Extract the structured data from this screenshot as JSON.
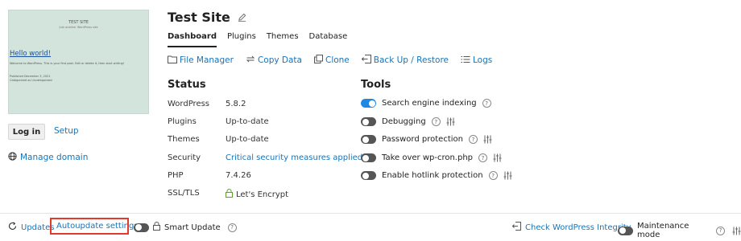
{
  "preview": {
    "site_title": "TEST SITE",
    "site_tagline": "Just another WordPress site",
    "post_title": "Hello world!",
    "post_text": "Welcome to WordPress. This is your first post. Edit or delete it, then start writing!",
    "post_meta1": "Published December 3, 2021",
    "post_meta2": "Categorized as Uncategorized"
  },
  "sidebar": {
    "login_label": "Log in",
    "setup_label": "Setup",
    "manage_domain_label": "Manage domain"
  },
  "header": {
    "title": "Test Site",
    "tabs": [
      "Dashboard",
      "Plugins",
      "Themes",
      "Database"
    ]
  },
  "toolbar": {
    "file_manager": "File Manager",
    "copy_data": "Copy Data",
    "clone": "Clone",
    "backup": "Back Up / Restore",
    "logs": "Logs"
  },
  "status": {
    "heading": "Status",
    "rows": [
      {
        "key": "WordPress",
        "value": "5.8.2"
      },
      {
        "key": "Plugins",
        "value": "Up-to-date"
      },
      {
        "key": "Themes",
        "value": "Up-to-date"
      },
      {
        "key": "Security",
        "value": "Critical security measures applied"
      },
      {
        "key": "PHP",
        "value": "7.4.26"
      },
      {
        "key": "SSL/TLS",
        "value": "Let's Encrypt"
      }
    ]
  },
  "tools": {
    "heading": "Tools",
    "items": [
      {
        "label": "Search engine indexing",
        "on": true
      },
      {
        "label": "Debugging",
        "on": false
      },
      {
        "label": "Password protection",
        "on": false
      },
      {
        "label": "Take over wp-cron.php",
        "on": false
      },
      {
        "label": "Enable hotlink protection",
        "on": false
      }
    ]
  },
  "footer": {
    "updates": "Updates",
    "autoupdate": "Autoupdate settings",
    "smart_update": "Smart Update",
    "check_integrity": "Check WordPress Integrity",
    "maintenance": "Maintenance mode"
  },
  "colors": {
    "link": "#1a73b8",
    "toggle_on": "#1e88e5",
    "highlight_box": "#e23b2e",
    "preview_bg": "#d3e4dc"
  }
}
